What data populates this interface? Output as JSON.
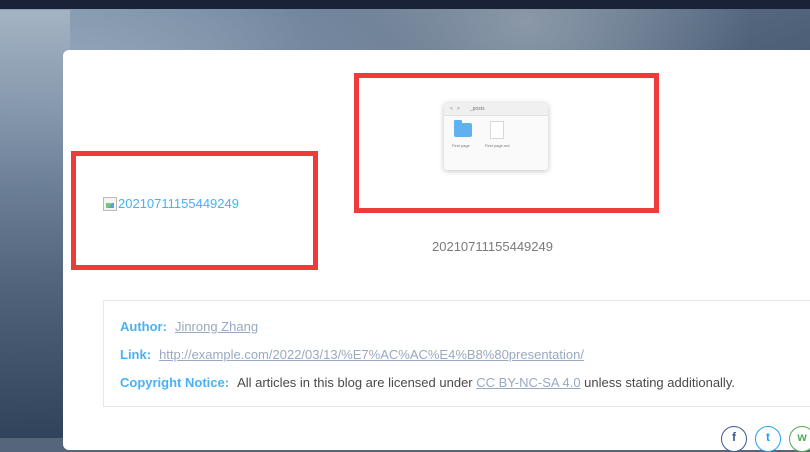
{
  "images": {
    "broken_alt": "20210711155449249",
    "caption": "20210711155449249",
    "finder": {
      "title": "_posts",
      "nav": [
        "<",
        ">"
      ],
      "items": [
        "First page",
        "First page.md"
      ]
    }
  },
  "copyright": {
    "author_label": "Author:",
    "author_value": "Jinrong Zhang",
    "link_label": "Link:",
    "link_value": "http://example.com/2022/03/13/%E7%AC%AC%E4%B8%80presentation/",
    "notice_label": "Copyright Notice:",
    "notice_text_before": "All articles in this blog are licensed under",
    "license_link": "CC BY-NC-SA 4.0",
    "notice_text_after": "unless stating additionally."
  },
  "share": {
    "facebook_icon": "f",
    "twitter_icon": "t",
    "wechat_icon": "w"
  },
  "colors": {
    "accent": "#49b1f5",
    "highlight_box": "#ef3b3b",
    "muted_link": "#99a9bf"
  }
}
